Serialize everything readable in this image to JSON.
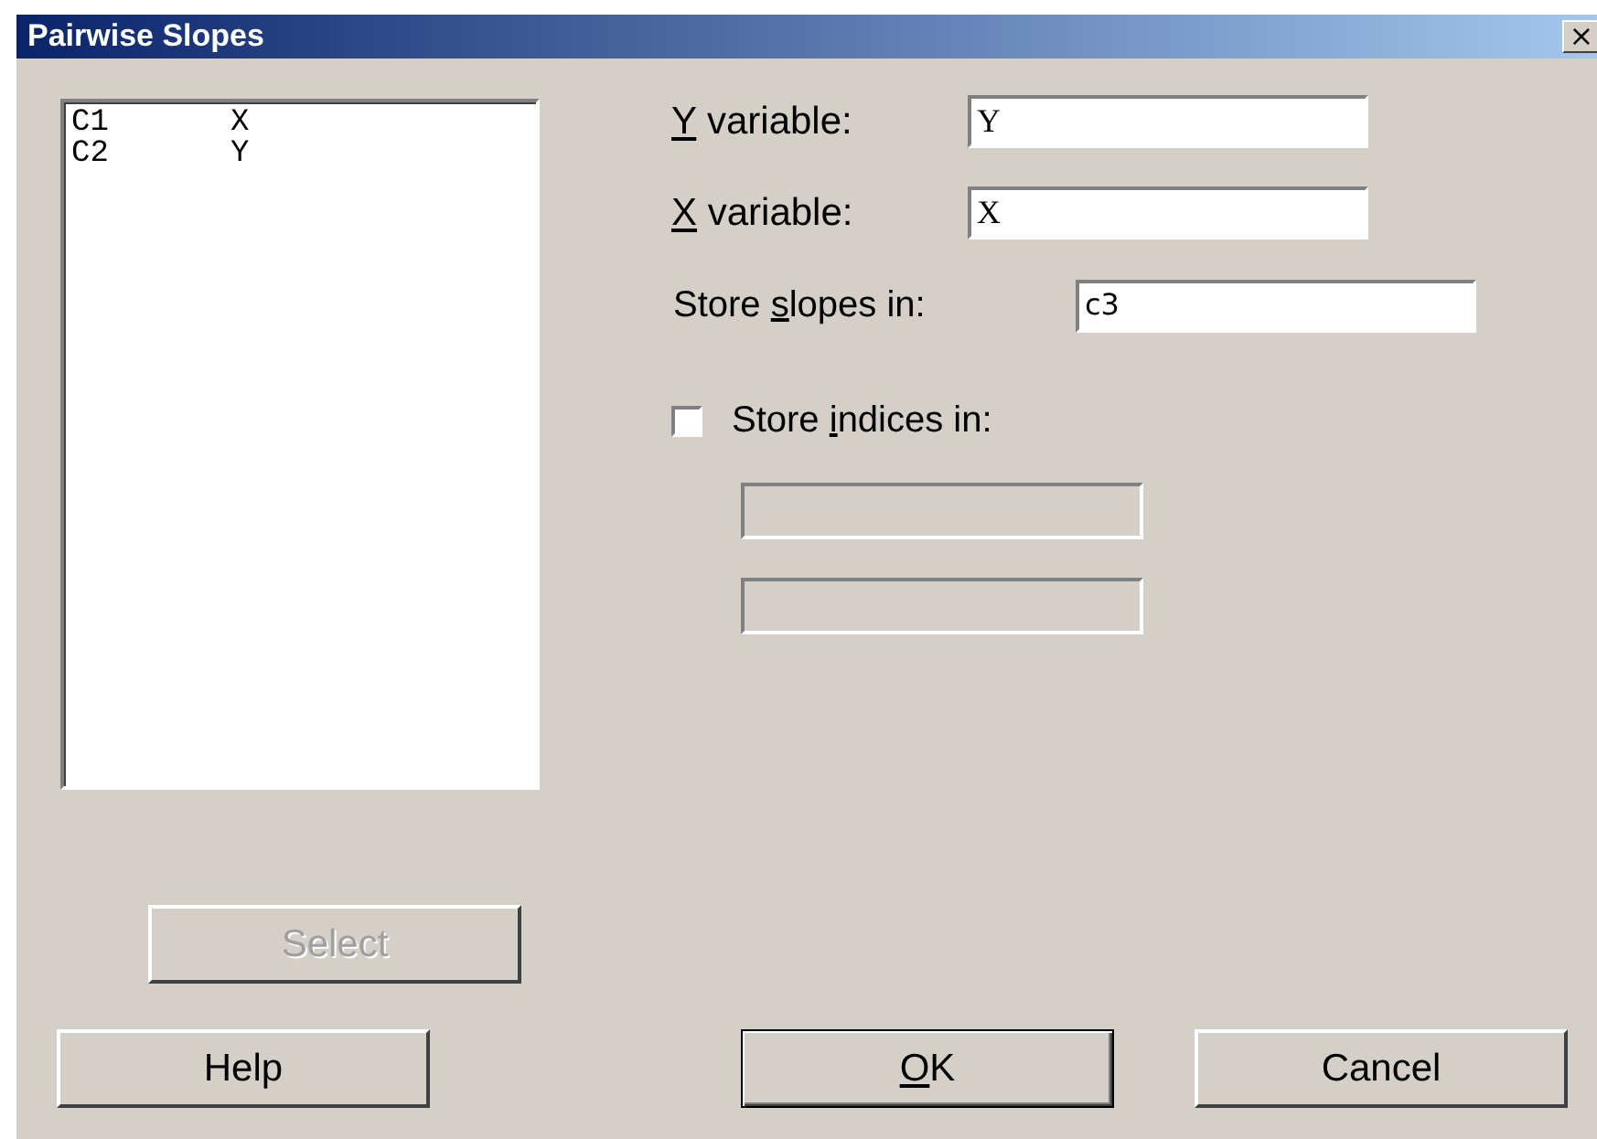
{
  "window": {
    "title": "Pairwise Slopes",
    "close": "×"
  },
  "variables_list": [
    {
      "column": "C1",
      "name": "X",
      "selected": false
    },
    {
      "column": "C2",
      "name": "Y",
      "selected": false
    }
  ],
  "select_button": {
    "label": "Select",
    "disabled": true
  },
  "fields": [
    {
      "label": {
        "key": "Y",
        "post": " variable:"
      },
      "value": "Y"
    },
    {
      "label": {
        "key": "X",
        "post": " variable:"
      },
      "value": "X"
    }
  ],
  "store_slopes": {
    "label": {
      "pre": "Store ",
      "key": "s",
      "post": "lopes in:"
    },
    "value": "c3"
  },
  "store_indices": {
    "checked": false,
    "label": {
      "pre": "Store ",
      "key": "i",
      "post": "ndices in:"
    },
    "fields": [
      {
        "disabled": true
      },
      {
        "disabled": true
      }
    ]
  },
  "buttons": [
    {
      "kind": "help",
      "label": {
        "pre": "Help"
      },
      "default": false
    },
    {
      "kind": "ok",
      "label": {
        "key": "O",
        "post": "K"
      },
      "default": true
    },
    {
      "kind": "cancel",
      "label": {
        "pre": "Cancel"
      },
      "default": false
    }
  ]
}
